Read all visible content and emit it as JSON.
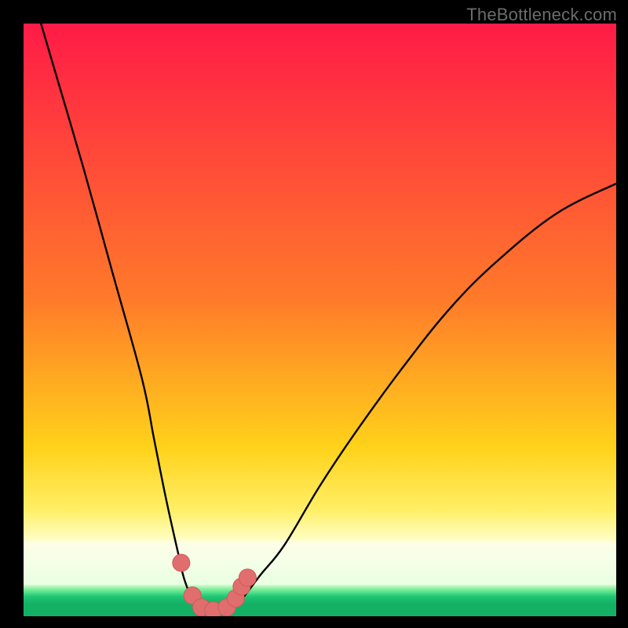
{
  "watermark": "TheBottleneck.com",
  "colors": {
    "frame": "#000000",
    "gradient_top": "#ff1b47",
    "gradient_mid1": "#ff7a2a",
    "gradient_mid2": "#ffd21a",
    "gradient_lower": "#ffef66",
    "gradient_pale": "#ffffcc",
    "green_band": "#13b163",
    "curve": "#000000",
    "marker_fill": "#e06e6e",
    "marker_stroke": "#d25a5a"
  },
  "chart_data": {
    "type": "line",
    "title": "",
    "xlabel": "",
    "ylabel": "",
    "xlim": [
      0,
      1
    ],
    "ylim": [
      0,
      100
    ],
    "annotations": [],
    "series": [
      {
        "name": "bottleneck-curve",
        "x": [
          0.0,
          0.05,
          0.1,
          0.15,
          0.2,
          0.22,
          0.24,
          0.26,
          0.272,
          0.29,
          0.31,
          0.33,
          0.36,
          0.4,
          0.44,
          0.5,
          0.56,
          0.64,
          0.72,
          0.8,
          0.9,
          1.0
        ],
        "values": [
          110.0,
          93.0,
          76.0,
          58.0,
          40.0,
          30.0,
          20.0,
          11.0,
          6.0,
          2.0,
          0.5,
          0.5,
          2.0,
          7.0,
          12.0,
          22.0,
          31.0,
          42.0,
          52.0,
          60.0,
          68.0,
          73.0
        ]
      }
    ],
    "markers": {
      "name": "highlighted-points",
      "x": [
        0.266,
        0.285,
        0.3,
        0.32,
        0.343,
        0.358,
        0.368,
        0.378
      ],
      "values": [
        9.0,
        3.5,
        1.5,
        1.0,
        1.5,
        3.0,
        5.0,
        6.5
      ]
    }
  }
}
